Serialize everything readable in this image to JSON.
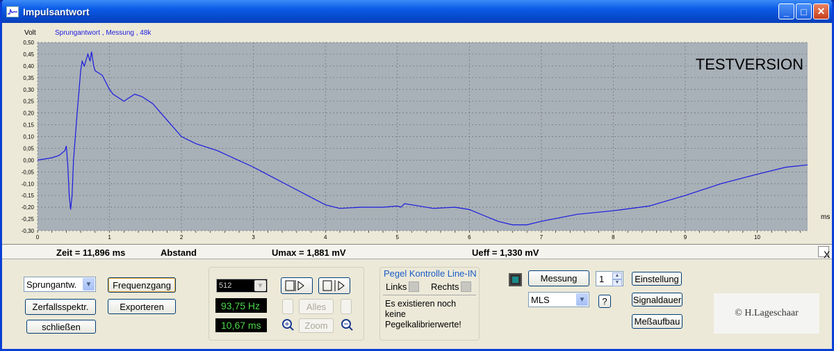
{
  "window": {
    "title": "Impulsantwort",
    "minimize": "_",
    "maximize": "□",
    "close": "✕"
  },
  "chart": {
    "ylabel": "Volt",
    "legend": "Sprungantwort , Messung , 48k",
    "watermark": "TESTVERSION",
    "xunit": "ms"
  },
  "chart_data": {
    "type": "line",
    "title": "",
    "ylabel": "Volt",
    "xlabel": "ms",
    "xlim": [
      0,
      10.7
    ],
    "ylim": [
      -0.3,
      0.5
    ],
    "grid": true,
    "xticks": [
      "0",
      "1",
      "2",
      "3",
      "4",
      "5",
      "6",
      "7",
      "8",
      "9",
      "10"
    ],
    "yticks": [
      "0,50",
      "0,45",
      "0,40",
      "0,35",
      "0,30",
      "0,25",
      "0,20",
      "0,15",
      "0,10",
      "0,05",
      "0,00",
      "-0,05",
      "-0,10",
      "-0,15",
      "-0,20",
      "-0,25",
      "-0,30"
    ],
    "series": [
      {
        "name": "Sprungantwort , Messung , 48k",
        "color": "#1a1ae0",
        "x": [
          0,
          0.2,
          0.3,
          0.38,
          0.4,
          0.42,
          0.44,
          0.46,
          0.48,
          0.5,
          0.55,
          0.6,
          0.62,
          0.65,
          0.68,
          0.7,
          0.73,
          0.75,
          0.78,
          0.8,
          0.85,
          0.9,
          0.95,
          1.0,
          1.05,
          1.1,
          1.15,
          1.2,
          1.25,
          1.3,
          1.35,
          1.45,
          1.6,
          1.8,
          2.0,
          2.2,
          2.5,
          3.0,
          3.5,
          4.0,
          4.2,
          4.5,
          4.8,
          5.0,
          5.05,
          5.1,
          5.2,
          5.5,
          5.8,
          6.0,
          6.2,
          6.4,
          6.6,
          6.8,
          7.0,
          7.5,
          8.0,
          8.5,
          9.0,
          9.5,
          10.0,
          10.4,
          10.7
        ],
        "y": [
          0.0,
          0.01,
          0.02,
          0.04,
          0.06,
          -0.02,
          -0.15,
          -0.21,
          -0.15,
          0.0,
          0.2,
          0.38,
          0.42,
          0.4,
          0.43,
          0.45,
          0.42,
          0.46,
          0.4,
          0.38,
          0.37,
          0.36,
          0.33,
          0.3,
          0.28,
          0.27,
          0.26,
          0.25,
          0.26,
          0.27,
          0.28,
          0.27,
          0.24,
          0.17,
          0.1,
          0.07,
          0.04,
          -0.03,
          -0.11,
          -0.19,
          -0.205,
          -0.2,
          -0.2,
          -0.195,
          -0.2,
          -0.185,
          -0.19,
          -0.205,
          -0.2,
          -0.21,
          -0.235,
          -0.26,
          -0.275,
          -0.275,
          -0.26,
          -0.23,
          -0.215,
          -0.195,
          -0.15,
          -0.1,
          -0.06,
          -0.03,
          -0.02
        ]
      }
    ]
  },
  "status": {
    "zeit": "Zeit = 11,896 ms",
    "abstand": "Abstand",
    "umax": "Umax = 1,881 mV",
    "ueff": "Ueff = 1,330 mV",
    "close": "X"
  },
  "controls": {
    "mode_select": "Sprungantw.",
    "frequenzgang": "Frequenzgang",
    "zerfallsspektr": "Zerfallsspektr.",
    "exportieren": "Exporteren",
    "schliessen": "schließen",
    "fft_size": "512",
    "freq_display": "93,75 Hz",
    "time_display": "10,67 ms",
    "alles": "Alles",
    "zoom": "Zoom",
    "pegel_title": "Pegel Kontrolle Line-IN",
    "links": "Links",
    "rechts": "Rechts",
    "pegel_msg": "Es existieren noch keine Pegelkalibrierwerte!",
    "messung": "Messung",
    "messung_count": "1",
    "method": "MLS",
    "help": "?",
    "einstellung": "Einstellung",
    "signaldauer": "Signaldauer",
    "messaufbau": "Meßaufbau",
    "copyright": "© H.Lageschaar"
  }
}
